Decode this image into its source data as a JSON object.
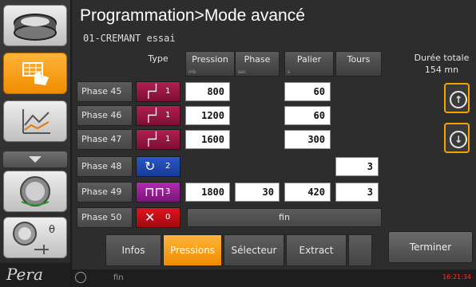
{
  "header": {
    "title": "Programmation>Mode avancé",
    "subtitle": "01-CREMANT essai"
  },
  "table": {
    "columns": [
      "Type",
      "Pression",
      "Phase",
      "Palier",
      "Tours"
    ],
    "rows": [
      {
        "label": "Phase 45",
        "type_num": "1",
        "pression": "800",
        "phase": "",
        "palier": "60",
        "tours": ""
      },
      {
        "label": "Phase 46",
        "type_num": "1",
        "pression": "1200",
        "phase": "",
        "palier": "60",
        "tours": ""
      },
      {
        "label": "Phase 47",
        "type_num": "1",
        "pression": "1600",
        "phase": "",
        "palier": "300",
        "tours": ""
      },
      {
        "label": "Phase 48",
        "type_num": "2",
        "pression": "",
        "phase": "",
        "palier": "",
        "tours": "3"
      },
      {
        "label": "Phase 49",
        "type_num": "3",
        "pression": "1800",
        "phase": "30",
        "palier": "420",
        "tours": "3"
      },
      {
        "label": "Phase 50",
        "type_num": "0",
        "fin": "fin"
      }
    ]
  },
  "duree": {
    "label": "Durée totale",
    "value": "154 mn"
  },
  "tabs": [
    "Infos",
    "Pressions",
    "Sélecteur",
    "Extract",
    ""
  ],
  "terminer_label": "Terminer",
  "footer": {
    "text": "fin",
    "time": "16:21:34"
  },
  "logo_text": "Pera",
  "sidebar_label_theta": "θ",
  "colors": {
    "accent": "#f5a000",
    "palier_type": "#9c1840",
    "loop_type": "#2050c0",
    "pulse_type": "#a020a0",
    "end_type": "#e01018"
  },
  "icons": {
    "sidebar": [
      "press-icon",
      "keypad-hand-icon",
      "chart-icon",
      "arrow-down-icon",
      "knob-icon",
      "valve-theta-icon"
    ],
    "types": [
      "step-up-icon",
      "loop-icon",
      "pulse-icon",
      "x-icon"
    ],
    "scroll": [
      "arrow-up-icon",
      "arrow-down-icon"
    ]
  }
}
